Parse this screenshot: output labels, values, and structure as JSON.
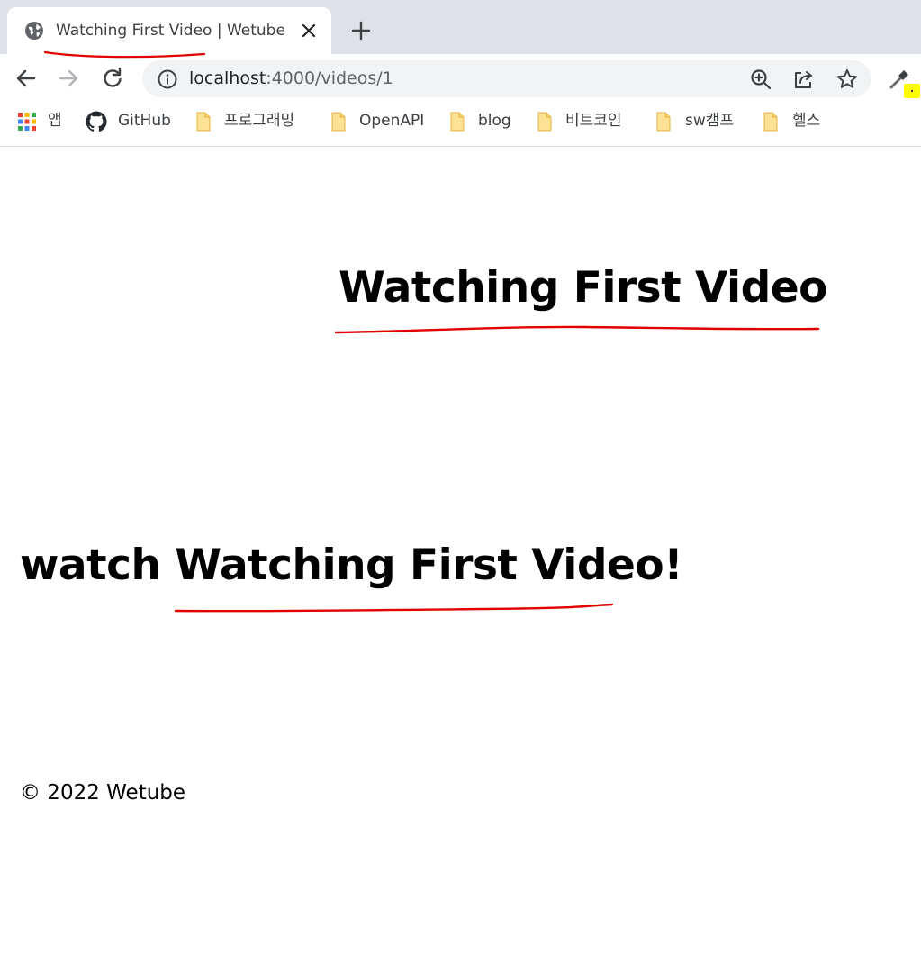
{
  "browser": {
    "tab": {
      "title": "Watching First Video | Wetube",
      "favicon": "globe-icon",
      "close_icon": "close-icon"
    },
    "new_tab_icon": "plus-icon",
    "nav": {
      "back_icon": "back-arrow-icon",
      "forward_icon": "forward-arrow-icon",
      "reload_icon": "reload-icon"
    },
    "address": {
      "host": "localhost",
      "path": ":4000/videos/1",
      "info_icon": "info-icon"
    },
    "omnibox_actions": [
      "zoom-icon",
      "share-icon",
      "star-icon"
    ],
    "extension_icon": "eyedropper-icon"
  },
  "bookmarks": [
    {
      "label": "앱",
      "icon": "apps-grid-icon"
    },
    {
      "label": "GitHub",
      "icon": "github-icon"
    },
    {
      "label": "프로그래밍",
      "icon": "folder-icon"
    },
    {
      "label": "OpenAPI",
      "icon": "folder-icon"
    },
    {
      "label": "blog",
      "icon": "folder-icon"
    },
    {
      "label": "비트코인",
      "icon": "folder-icon"
    },
    {
      "label": "sw캠프",
      "icon": "folder-icon"
    },
    {
      "label": "헬스",
      "icon": "folder-icon"
    }
  ],
  "page": {
    "heading": "Watching First Video",
    "watch_prefix": "watch ",
    "watch_title": "Watching First Video",
    "watch_suffix": "!",
    "footer": "© 2022 Wetube"
  },
  "colors": {
    "annotation": "#e00000",
    "tabstrip_bg": "#dee1e6",
    "omnibox_bg": "#f1f3f4",
    "folder": "#fde293"
  }
}
